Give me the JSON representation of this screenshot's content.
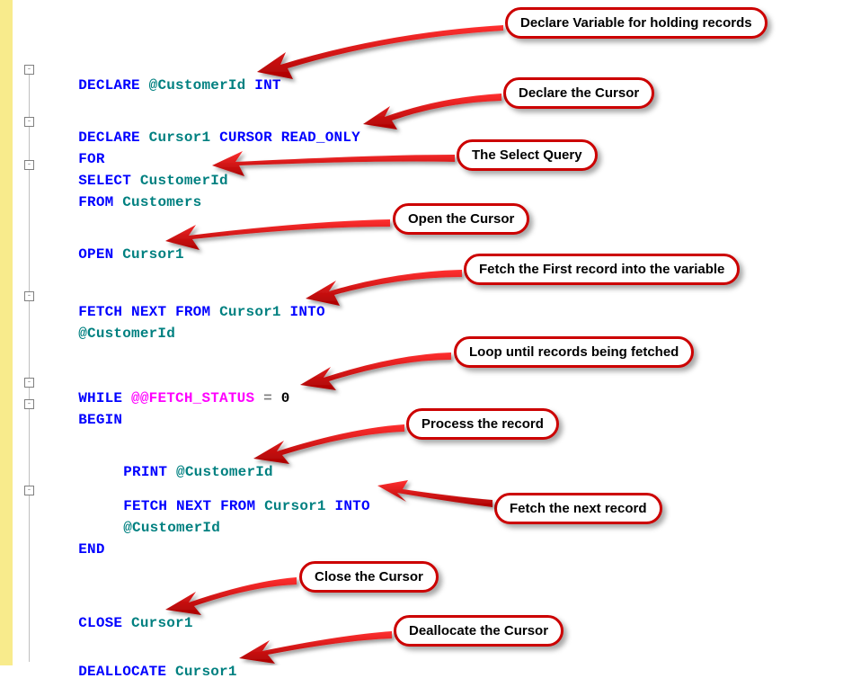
{
  "code": {
    "l1_declare": "DECLARE",
    "l1_var": "@CustomerId",
    "l1_type": "INT",
    "l2_declare": "DECLARE",
    "l2_name": "Cursor1",
    "l2_cursor": "CURSOR",
    "l2_ro": "READ_ONLY",
    "l3_for": "FOR",
    "l4_select": "SELECT",
    "l4_col": "CustomerId",
    "l5_from": "FROM",
    "l5_tbl": "Customers",
    "l6_open": "OPEN",
    "l6_name": "Cursor1",
    "l7_fetch": "FETCH",
    "l7_next": "NEXT",
    "l7_from": "FROM",
    "l7_name": "Cursor1",
    "l7_into": "INTO",
    "l8_var": "@CustomerId",
    "l9_while": "WHILE",
    "l9_fs": "@@FETCH_STATUS",
    "l9_eq": "=",
    "l9_zero": "0",
    "l10_begin": "BEGIN",
    "l11_print": "PRINT",
    "l11_var": "@CustomerId",
    "l12_fetch": "FETCH",
    "l12_next": "NEXT",
    "l12_from": "FROM",
    "l12_name": "Cursor1",
    "l12_into": "INTO",
    "l13_var": "@CustomerId",
    "l14_end": "END",
    "l15_close": "CLOSE",
    "l15_name": "Cursor1",
    "l16_dealloc": "DEALLOCATE",
    "l16_name": "Cursor1"
  },
  "callouts": {
    "c1": "Declare Variable for holding records",
    "c2": "Declare the Cursor",
    "c3": "The Select Query",
    "c4": "Open the Cursor",
    "c5": "Fetch the First record into the variable",
    "c6": "Loop until records being fetched",
    "c7": "Process the record",
    "c8": "Fetch the next record",
    "c9": "Close the Cursor",
    "c10": "Deallocate the Cursor"
  },
  "fold": {
    "minus": "-"
  }
}
